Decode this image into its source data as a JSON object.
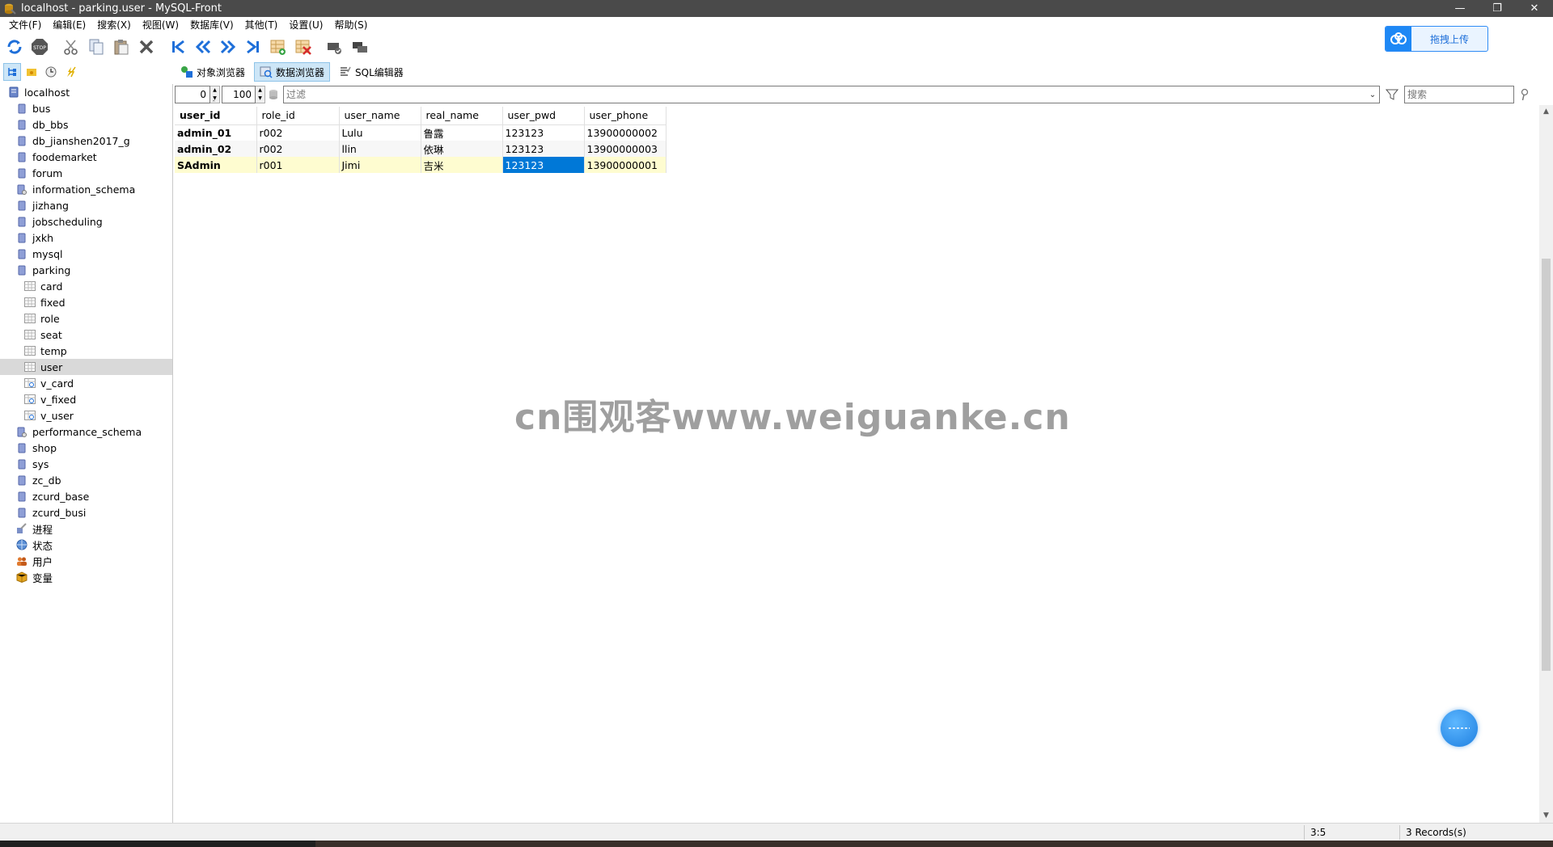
{
  "window": {
    "title": "localhost - parking.user - MySQL-Front"
  },
  "menu": [
    "文件(F)",
    "编辑(E)",
    "搜索(X)",
    "视图(W)",
    "数据库(V)",
    "其他(T)",
    "设置(U)",
    "帮助(S)"
  ],
  "upload_widget": {
    "label": "拖拽上传"
  },
  "view_tabs": [
    {
      "label": "对象浏览器",
      "active": false
    },
    {
      "label": "数据浏览器",
      "active": true
    },
    {
      "label": "SQL编辑器",
      "active": false
    }
  ],
  "tree": {
    "root": "localhost",
    "databases": [
      "bus",
      "db_bbs",
      "db_jianshen2017_g",
      "foodemarket",
      "forum",
      "information_schema",
      "jizhang",
      "jobscheduling",
      "jxkh",
      "mysql"
    ],
    "parking": {
      "name": "parking",
      "tables": [
        "card",
        "fixed",
        "role",
        "seat",
        "temp",
        "user"
      ],
      "views": [
        "v_card",
        "v_fixed",
        "v_user"
      ],
      "selected": "user"
    },
    "databases_after": [
      "performance_schema",
      "shop",
      "sys",
      "zc_db",
      "zcurd_base",
      "zcurd_busi"
    ],
    "system": [
      "进程",
      "状态",
      "用户",
      "变量"
    ]
  },
  "filterbar": {
    "offset": "0",
    "limit": "100",
    "filter_placeholder": "过滤",
    "search_placeholder": "搜索"
  },
  "grid": {
    "columns": [
      "user_id",
      "role_id",
      "user_name",
      "real_name",
      "user_pwd",
      "user_phone"
    ],
    "rows": [
      [
        "admin_01",
        "r002",
        "Lulu",
        "鲁露",
        "123123",
        "13900000002"
      ],
      [
        "admin_02",
        "r002",
        "llin",
        "依琳",
        "123123",
        "13900000003"
      ],
      [
        "SAdmin",
        "r001",
        "Jimi",
        "吉米",
        "123123",
        "13900000001"
      ]
    ]
  },
  "watermark": "cn围观客www.weiguanke.cn",
  "status": {
    "position": "3:5",
    "records": "3 Records(s)"
  }
}
